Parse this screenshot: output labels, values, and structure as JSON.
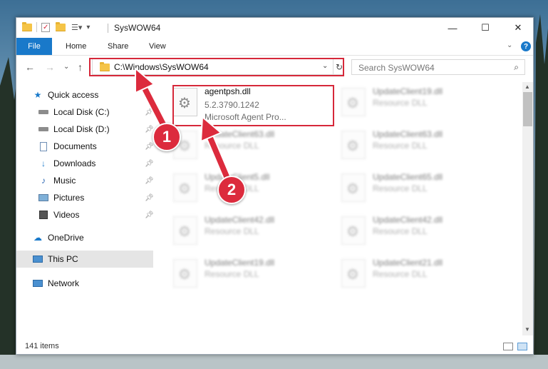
{
  "window": {
    "title": "SysWOW64",
    "minimize_label": "—",
    "maximize_label": "☐",
    "close_label": "✕"
  },
  "ribbon": {
    "tabs": [
      "File",
      "Home",
      "Share",
      "View"
    ],
    "help_label": "?"
  },
  "address": {
    "path": "C:\\Windows\\SysWOW64",
    "dropdown_glyph": "⌄",
    "refresh_glyph": "↻"
  },
  "search": {
    "placeholder": "Search SysWOW64"
  },
  "nav": {
    "back": "←",
    "forward": "→",
    "recent": "⌄",
    "up": "↑"
  },
  "sidebar": {
    "items": [
      {
        "label": "Quick access",
        "icon": "star-icon"
      },
      {
        "label": "Local Disk (C:)",
        "icon": "drive-icon",
        "pinned": true
      },
      {
        "label": "Local Disk (D:)",
        "icon": "drive-icon",
        "pinned": true
      },
      {
        "label": "Documents",
        "icon": "documents-icon",
        "pinned": true
      },
      {
        "label": "Downloads",
        "icon": "download-icon",
        "pinned": true
      },
      {
        "label": "Music",
        "icon": "music-icon",
        "pinned": true
      },
      {
        "label": "Pictures",
        "icon": "pictures-icon",
        "pinned": true
      },
      {
        "label": "Videos",
        "icon": "videos-icon",
        "pinned": true
      },
      {
        "label": "OneDrive",
        "icon": "cloud-icon"
      },
      {
        "label": "This PC",
        "icon": "computer-icon",
        "selected": true
      },
      {
        "label": "Network",
        "icon": "network-icon"
      }
    ]
  },
  "files": [
    {
      "name": "agentpsh.dll",
      "line2": "5.2.3790.1242",
      "line3": "Microsoft Agent Pro..."
    },
    {
      "name": "UpdateClient19.dll",
      "line2": "Resource DLL"
    },
    {
      "name": "UpdateClient63.dll",
      "line2": "Resource DLL"
    },
    {
      "name": "UpdateClient63.dll",
      "line2": "Resource DLL"
    },
    {
      "name": "UpdateClient5.dll",
      "line2": "Resource DLL"
    },
    {
      "name": "UpdateClient65.dll",
      "line2": "Resource DLL"
    },
    {
      "name": "UpdateClient42.dll",
      "line2": "Resource DLL"
    },
    {
      "name": "UpdateClient42.dll",
      "line2": "Resource DLL"
    },
    {
      "name": "UpdateClient19.dll",
      "line2": "Resource DLL"
    },
    {
      "name": "UpdateClient21.dll",
      "line2": "Resource DLL"
    }
  ],
  "status": {
    "item_count": "141 items"
  },
  "callouts": [
    "1",
    "2"
  ],
  "colors": {
    "accent": "#1979ca",
    "highlight": "#d6283a",
    "callout": "#dc2b3d"
  }
}
